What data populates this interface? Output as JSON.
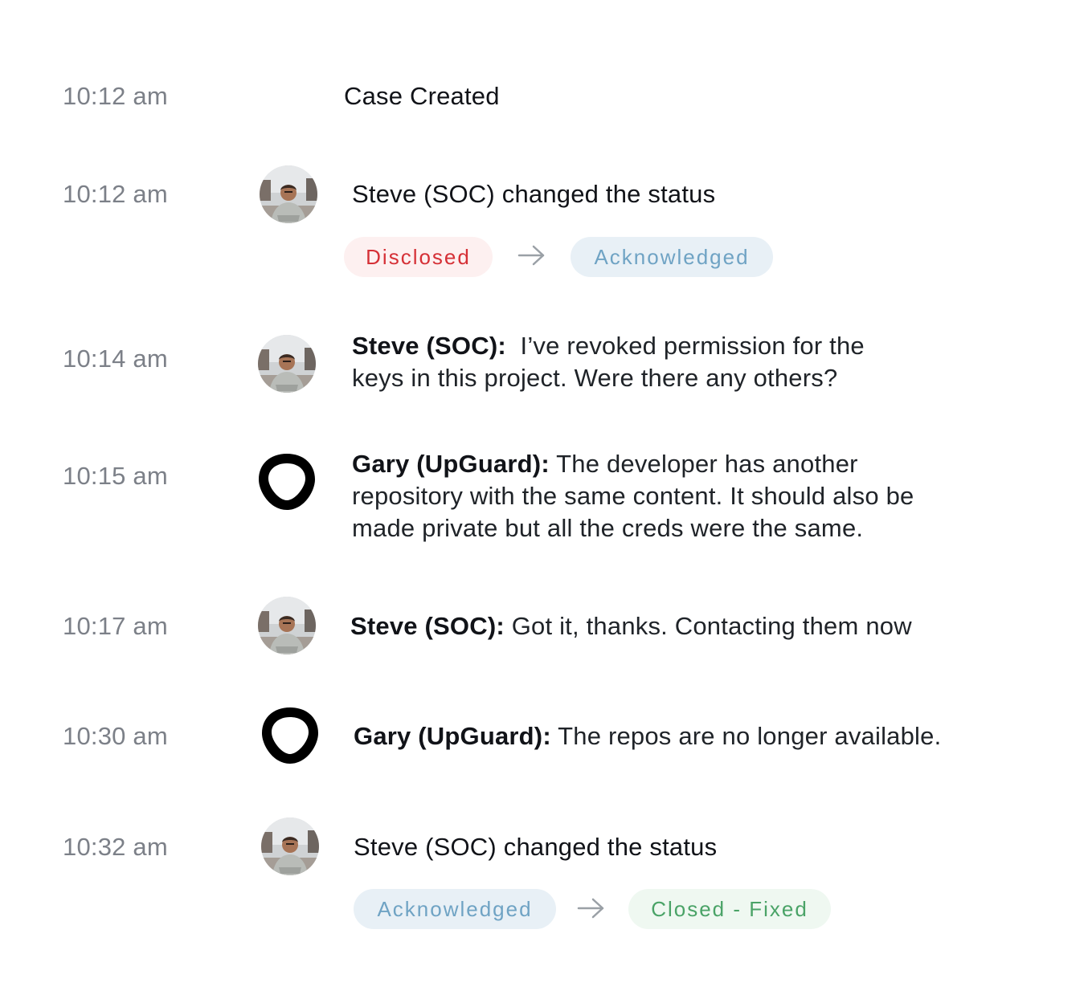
{
  "events": [
    {
      "time": "10:12 am",
      "text": "Case Created"
    },
    {
      "time": "10:12 am",
      "author": "Steve (SOC)",
      "text": "changed the status",
      "from_status": "Disclosed",
      "to_status": "Acknowledged"
    },
    {
      "time": "10:14 am",
      "author": "Steve (SOC):",
      "line1": "I’ve revoked permission for the",
      "line2": "keys in this project. Were there any others?"
    },
    {
      "time": "10:15 am",
      "author": "Gary (UpGuard):",
      "line1": "The developer has another",
      "line2": "repository with the same content. It should also be",
      "line3": "made private but all the creds were the same."
    },
    {
      "time": "10:17 am",
      "author": "Steve (SOC):",
      "text": "Got it, thanks. Contacting them now"
    },
    {
      "time": "10:30 am",
      "author": "Gary (UpGuard):",
      "text": "The repos are no longer available."
    },
    {
      "time": "10:32 am",
      "author": "Steve (SOC)",
      "text": "changed the status",
      "from_status": "Acknowledged",
      "to_status": "Closed - Fixed"
    }
  ],
  "colors": {
    "time_gray": "#7c8088",
    "disclosed_bg": "#fdf0f0",
    "disclosed_fg": "#d53036",
    "acknowledged_bg": "#e8f0f6",
    "acknowledged_fg": "#6fa3c4",
    "closed_bg": "#eff8f1",
    "closed_fg": "#4aa367"
  },
  "icons": {
    "steve": "steve-avatar",
    "gary": "upguard-logo-icon",
    "arrow": "arrow-right-icon"
  }
}
